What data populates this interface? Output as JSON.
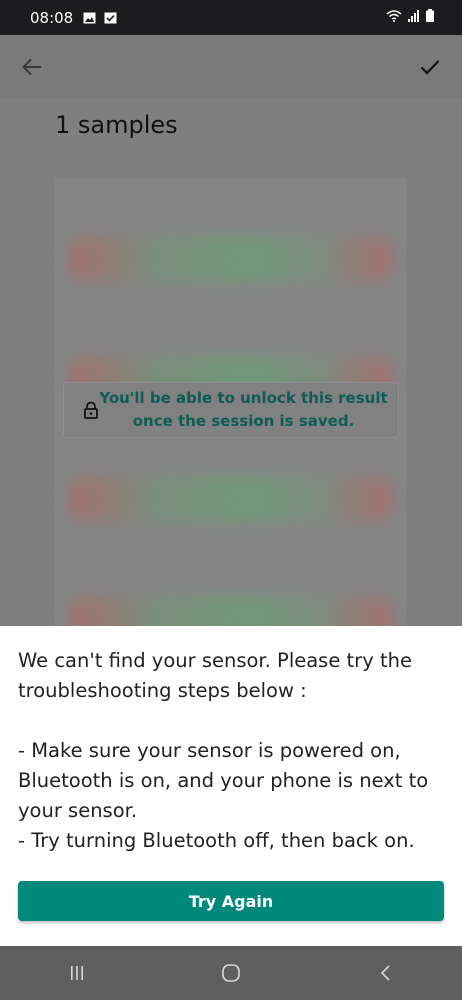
{
  "status_bar": {
    "time": "08:08",
    "icons": [
      "image-icon",
      "checkbox-icon",
      "wifi-icon",
      "signal-icon",
      "battery-icon"
    ]
  },
  "app_bar": {
    "back_icon": "arrow-left-icon",
    "confirm_icon": "check-icon"
  },
  "content": {
    "title": "1 samples",
    "lock_notice": "You'll be able to unlock this result once the session is saved."
  },
  "sheet": {
    "message": "We can't find your sensor. Please try the troubleshooting steps below :\n\n- Make sure your sensor is powered on, Bluetooth is on, and your phone is next to your sensor.\n- Try turning Bluetooth off, then back on.",
    "button_label": "Try Again"
  },
  "nav_bar": {
    "icons": [
      "recent-apps-icon",
      "home-icon",
      "back-icon"
    ]
  },
  "colors": {
    "accent": "#00897b",
    "notice_text": "#0d5d52"
  }
}
